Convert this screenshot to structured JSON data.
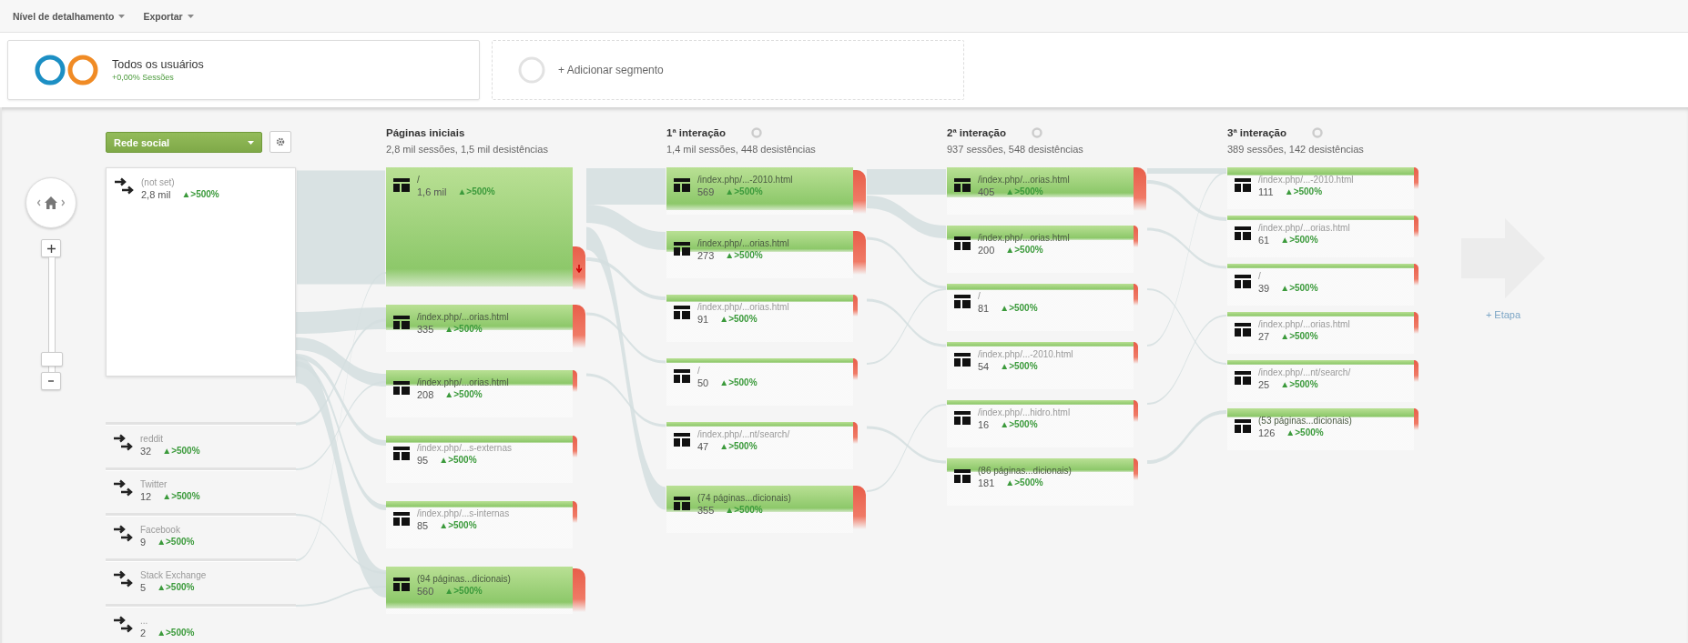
{
  "toolbar": [
    "Nível de detalhamento",
    "Exportar"
  ],
  "segments": [
    {
      "kind": "active",
      "title": "Todos os usuários",
      "subtitle": "+0,00% Sessões"
    },
    {
      "kind": "add",
      "title": "+ Adicionar segmento"
    }
  ],
  "navigator": {
    "zoom": {
      "level": 0.05
    }
  },
  "columns": [
    {
      "kind": "source",
      "dimension": "Rede social",
      "nodes": [
        {
          "label": "(not set)",
          "count": "2,8 mil",
          "change": "▲>500%"
        },
        {
          "label": "reddit",
          "count": "32",
          "change": "▲>500%"
        },
        {
          "label": "Twitter",
          "count": "12",
          "change": "▲>500%"
        },
        {
          "label": "Facebook",
          "count": "9",
          "change": "▲>500%"
        },
        {
          "label": "Stack Exchange",
          "count": "5",
          "change": "▲>500%"
        },
        {
          "label": "...",
          "count": "2",
          "change": "▲>500%"
        }
      ]
    },
    {
      "kind": "start",
      "title": "Páginas iniciais",
      "summary": "2,8 mil sessões, 1,5 mil desistências",
      "nodes": [
        {
          "label": "/",
          "count": "1,6 mil",
          "change": "▲>500%"
        },
        {
          "label": "/index.php/...orias.html",
          "count": "335",
          "change": "▲>500%"
        },
        {
          "label": "/index.php/...orias.html",
          "count": "208",
          "change": "▲>500%"
        },
        {
          "label": "/index.php/...s-externas",
          "count": "95",
          "change": "▲>500%"
        },
        {
          "label": "/index.php/...s-internas",
          "count": "85",
          "change": "▲>500%"
        },
        {
          "label": "(94 páginas...dicionais)",
          "count": "560",
          "change": "▲>500%"
        }
      ]
    },
    {
      "kind": "interaction",
      "title": "1ª interação",
      "summary": "1,4 mil sessões, 448 desistências",
      "nodes": [
        {
          "label": "/index.php/...-2010.html",
          "count": "569",
          "change": "▲>500%"
        },
        {
          "label": "/index.php/...orias.html",
          "count": "273",
          "change": "▲>500%"
        },
        {
          "label": "/index.php/...orias.html",
          "count": "91",
          "change": "▲>500%"
        },
        {
          "label": "/",
          "count": "50",
          "change": "▲>500%"
        },
        {
          "label": "/index.php/...nt/search/",
          "count": "47",
          "change": "▲>500%"
        },
        {
          "label": "(74 páginas...dicionais)",
          "count": "355",
          "change": "▲>500%"
        }
      ]
    },
    {
      "kind": "interaction",
      "title": "2ª interação",
      "summary": "937 sessões, 548 desistências",
      "nodes": [
        {
          "label": "/index.php/...orias.html",
          "count": "405",
          "change": "▲>500%"
        },
        {
          "label": "/index.php/...orias.html",
          "count": "200",
          "change": "▲>500%"
        },
        {
          "label": "/",
          "count": "81",
          "change": "▲>500%"
        },
        {
          "label": "/index.php/...-2010.html",
          "count": "54",
          "change": "▲>500%"
        },
        {
          "label": "/index.php/...hidro.html",
          "count": "16",
          "change": "▲>500%"
        },
        {
          "label": "(86 páginas...dicionais)",
          "count": "181",
          "change": "▲>500%"
        }
      ]
    },
    {
      "kind": "interaction",
      "title": "3ª interação",
      "summary": "389 sessões, 142 desistências",
      "nodes": [
        {
          "label": "/index.php/...-2010.html",
          "count": "111",
          "change": "▲>500%"
        },
        {
          "label": "/index.php/...orias.html",
          "count": "61",
          "change": "▲>500%"
        },
        {
          "label": "/",
          "count": "39",
          "change": "▲>500%"
        },
        {
          "label": "/index.php/...orias.html",
          "count": "27",
          "change": "▲>500%"
        },
        {
          "label": "/index.php/...nt/search/",
          "count": "25",
          "change": "▲>500%"
        },
        {
          "label": "(53 páginas...dicionais)",
          "count": "126",
          "change": "▲>500%"
        }
      ]
    }
  ],
  "add_step": {
    "label": "+ Etapa"
  }
}
